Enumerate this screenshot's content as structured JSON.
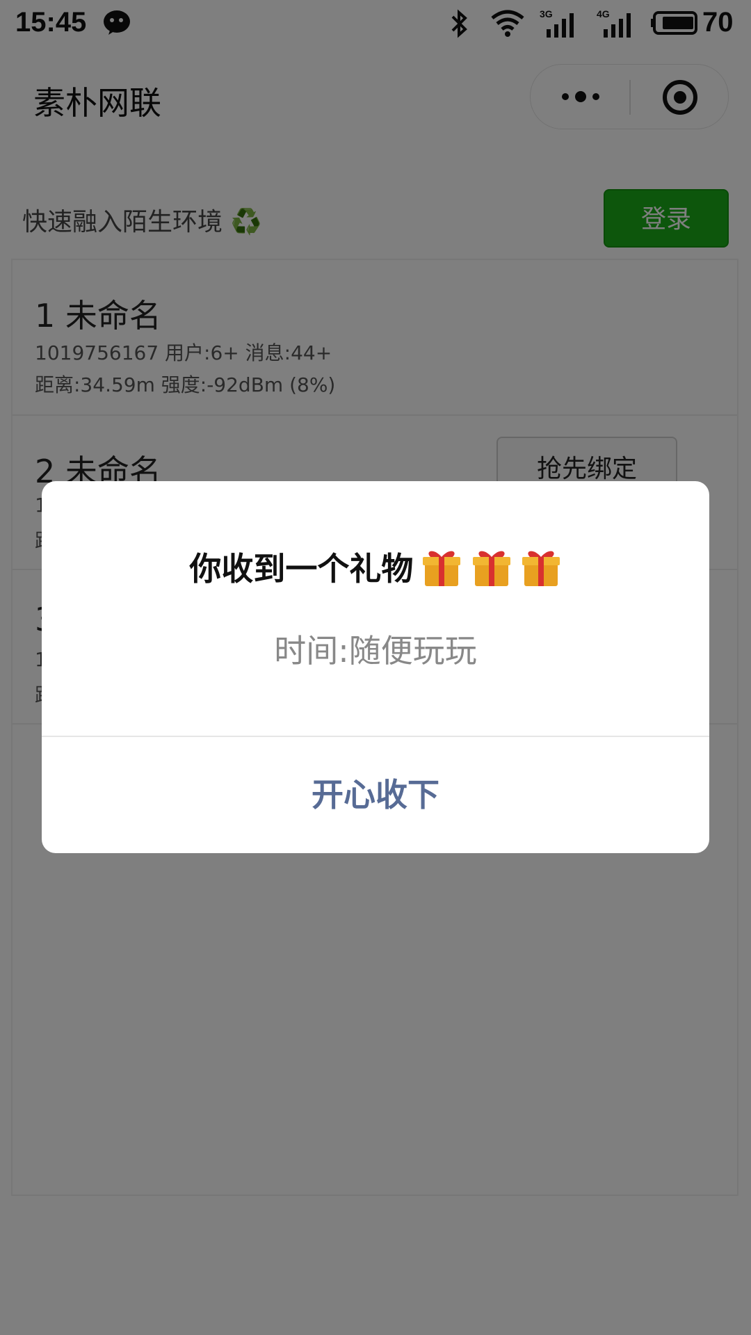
{
  "status_bar": {
    "time": "15:45",
    "signal_1_label": "3G",
    "signal_2_label": "4G",
    "battery": "70",
    "icons": [
      "wechat-icon",
      "bluetooth-icon",
      "wifi-icon",
      "signal-icon",
      "battery-icon"
    ]
  },
  "nav": {
    "title": "素朴网联",
    "icons": [
      "more-icon",
      "target-icon"
    ]
  },
  "header": {
    "text": "快速融入陌生环境 ♻️",
    "login_label": "登录",
    "accent": "#1aad19"
  },
  "list": {
    "items": [
      {
        "title": "1 未命名",
        "line1": "1019756167 用户:6+ 消息:44+",
        "line2": "距离:34.59m 强度:-92dBm (8%)"
      },
      {
        "title": "2 未命名",
        "line1": "1",
        "line2": "距",
        "action": "抢先绑定"
      },
      {
        "title": "3",
        "line1": "1",
        "line2": "距"
      }
    ]
  },
  "modal": {
    "title": "你收到一个礼物",
    "gift_icons": [
      "gift-icon",
      "gift-icon",
      "gift-icon"
    ],
    "content": "时间:随便玩玩",
    "confirm_label": "开心收下",
    "confirm_color": "#576b95"
  }
}
